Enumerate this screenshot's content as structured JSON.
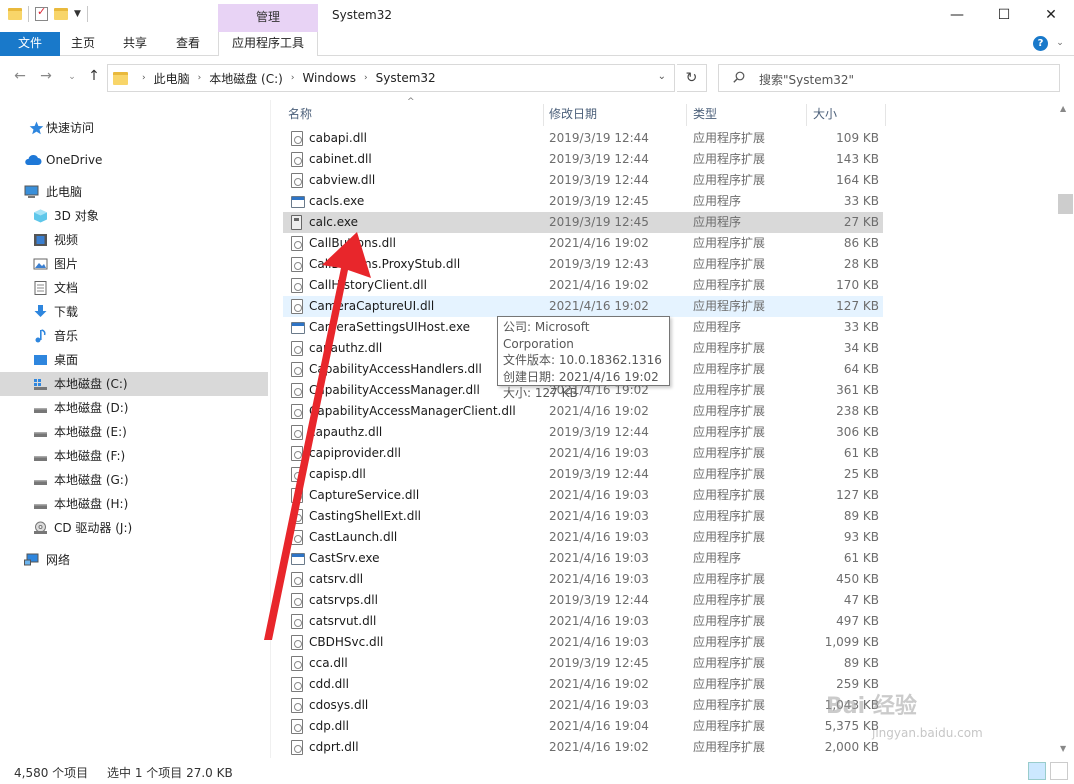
{
  "window": {
    "title": "System32",
    "context_tab_header": "管理",
    "minimize": "—",
    "maximize": "☐",
    "close": "✕"
  },
  "ribbon": {
    "file": "文件",
    "tabs": [
      "主页",
      "共享",
      "查看",
      "应用程序工具"
    ],
    "help": "?"
  },
  "address": {
    "crumbs": [
      "此电脑",
      "本地磁盘 (C:)",
      "Windows",
      "System32"
    ],
    "search_placeholder": "搜索\"System32\""
  },
  "sidebar": {
    "items": [
      {
        "label": "快速访问",
        "icon": "star-icon"
      },
      {
        "label": "OneDrive",
        "icon": "cloud-icon"
      },
      {
        "label": "此电脑",
        "icon": "computer-icon"
      },
      {
        "label": "3D 对象",
        "icon": "cube-icon"
      },
      {
        "label": "视频",
        "icon": "video-icon"
      },
      {
        "label": "图片",
        "icon": "picture-icon"
      },
      {
        "label": "文档",
        "icon": "document-icon"
      },
      {
        "label": "下载",
        "icon": "download-icon"
      },
      {
        "label": "音乐",
        "icon": "music-icon"
      },
      {
        "label": "桌面",
        "icon": "desktop-icon"
      },
      {
        "label": "本地磁盘 (C:)",
        "icon": "drive-icon"
      },
      {
        "label": "本地磁盘 (D:)",
        "icon": "drive-icon"
      },
      {
        "label": "本地磁盘 (E:)",
        "icon": "drive-icon"
      },
      {
        "label": "本地磁盘 (F:)",
        "icon": "drive-icon"
      },
      {
        "label": "本地磁盘 (G:)",
        "icon": "drive-icon"
      },
      {
        "label": "本地磁盘 (H:)",
        "icon": "drive-icon"
      },
      {
        "label": "CD 驱动器 (J:)",
        "icon": "cd-drive-icon"
      },
      {
        "label": "网络",
        "icon": "network-icon"
      }
    ]
  },
  "columns": {
    "name": "名称",
    "date": "修改日期",
    "type": "类型",
    "size": "大小"
  },
  "files": [
    {
      "name": "cabapi.dll",
      "date": "2019/3/19 12:44",
      "type": "应用程序扩展",
      "size": "109 KB",
      "kind": "dll"
    },
    {
      "name": "cabinet.dll",
      "date": "2019/3/19 12:44",
      "type": "应用程序扩展",
      "size": "143 KB",
      "kind": "dll"
    },
    {
      "name": "cabview.dll",
      "date": "2019/3/19 12:44",
      "type": "应用程序扩展",
      "size": "164 KB",
      "kind": "dll"
    },
    {
      "name": "cacls.exe",
      "date": "2019/3/19 12:45",
      "type": "应用程序",
      "size": "33 KB",
      "kind": "exe"
    },
    {
      "name": "calc.exe",
      "date": "2019/3/19 12:45",
      "type": "应用程序",
      "size": "27 KB",
      "kind": "calc",
      "selected": true
    },
    {
      "name": "CallButtons.dll",
      "date": "2021/4/16 19:02",
      "type": "应用程序扩展",
      "size": "86 KB",
      "kind": "dll"
    },
    {
      "name": "CallButtons.ProxyStub.dll",
      "date": "2019/3/19 12:43",
      "type": "应用程序扩展",
      "size": "28 KB",
      "kind": "dll"
    },
    {
      "name": "CallHistoryClient.dll",
      "date": "2021/4/16 19:02",
      "type": "应用程序扩展",
      "size": "170 KB",
      "kind": "dll"
    },
    {
      "name": "CameraCaptureUI.dll",
      "date": "2021/4/16 19:02",
      "type": "应用程序扩展",
      "size": "127 KB",
      "kind": "dll",
      "hover": true
    },
    {
      "name": "CameraSettingsUIHost.exe",
      "date": "",
      "type": "应用程序",
      "size": "33 KB",
      "kind": "exe"
    },
    {
      "name": "capauthz.dll",
      "date": "",
      "type": "应用程序扩展",
      "size": "34 KB",
      "kind": "dll"
    },
    {
      "name": "CapabilityAccessHandlers.dll",
      "date": "",
      "type": "应用程序扩展",
      "size": "64 KB",
      "kind": "dll"
    },
    {
      "name": "CapabilityAccessManager.dll",
      "date": "2021/4/16 19:02",
      "type": "应用程序扩展",
      "size": "361 KB",
      "kind": "dll"
    },
    {
      "name": "CapabilityAccessManagerClient.dll",
      "date": "2021/4/16 19:02",
      "type": "应用程序扩展",
      "size": "238 KB",
      "kind": "dll"
    },
    {
      "name": "capauthz.dll",
      "date": "2019/3/19 12:44",
      "type": "应用程序扩展",
      "size": "306 KB",
      "kind": "dll"
    },
    {
      "name": "capiprovider.dll",
      "date": "2021/4/16 19:03",
      "type": "应用程序扩展",
      "size": "61 KB",
      "kind": "dll"
    },
    {
      "name": "capisp.dll",
      "date": "2019/3/19 12:44",
      "type": "应用程序扩展",
      "size": "25 KB",
      "kind": "dll"
    },
    {
      "name": "CaptureService.dll",
      "date": "2021/4/16 19:03",
      "type": "应用程序扩展",
      "size": "127 KB",
      "kind": "dll"
    },
    {
      "name": "CastingShellExt.dll",
      "date": "2021/4/16 19:03",
      "type": "应用程序扩展",
      "size": "89 KB",
      "kind": "dll"
    },
    {
      "name": "CastLaunch.dll",
      "date": "2021/4/16 19:03",
      "type": "应用程序扩展",
      "size": "93 KB",
      "kind": "dll"
    },
    {
      "name": "CastSrv.exe",
      "date": "2021/4/16 19:03",
      "type": "应用程序",
      "size": "61 KB",
      "kind": "exe"
    },
    {
      "name": "catsrv.dll",
      "date": "2021/4/16 19:03",
      "type": "应用程序扩展",
      "size": "450 KB",
      "kind": "dll"
    },
    {
      "name": "catsrvps.dll",
      "date": "2019/3/19 12:44",
      "type": "应用程序扩展",
      "size": "47 KB",
      "kind": "dll"
    },
    {
      "name": "catsrvut.dll",
      "date": "2021/4/16 19:03",
      "type": "应用程序扩展",
      "size": "497 KB",
      "kind": "dll"
    },
    {
      "name": "CBDHSvc.dll",
      "date": "2021/4/16 19:03",
      "type": "应用程序扩展",
      "size": "1,099 KB",
      "kind": "dll"
    },
    {
      "name": "cca.dll",
      "date": "2019/3/19 12:45",
      "type": "应用程序扩展",
      "size": "89 KB",
      "kind": "dll"
    },
    {
      "name": "cdd.dll",
      "date": "2021/4/16 19:02",
      "type": "应用程序扩展",
      "size": "259 KB",
      "kind": "dll"
    },
    {
      "name": "cdosys.dll",
      "date": "2021/4/16 19:03",
      "type": "应用程序扩展",
      "size": "1,043 KB",
      "kind": "dll"
    },
    {
      "name": "cdp.dll",
      "date": "2021/4/16 19:04",
      "type": "应用程序扩展",
      "size": "5,375 KB",
      "kind": "dll"
    },
    {
      "name": "cdprt.dll",
      "date": "2021/4/16 19:02",
      "type": "应用程序扩展",
      "size": "2,000 KB",
      "kind": "dll"
    }
  ],
  "tooltip": {
    "company": "公司: Microsoft Corporation",
    "version": "文件版本: 10.0.18362.1316",
    "created": "创建日期: 2021/4/16 19:02",
    "size": "大小: 127 KB"
  },
  "status": {
    "count": "4,580 个项目",
    "selection": "选中 1 个项目  27.0 KB"
  },
  "watermark": {
    "logo": "Bai 经验",
    "url": "jingyan.baidu.com"
  },
  "colors": {
    "accent": "#1979ca",
    "context_tab": "#e8d3f5",
    "selected_row": "#d9d9d9",
    "hover_row": "#e5f3ff",
    "annotation_arrow": "#e8262b"
  }
}
